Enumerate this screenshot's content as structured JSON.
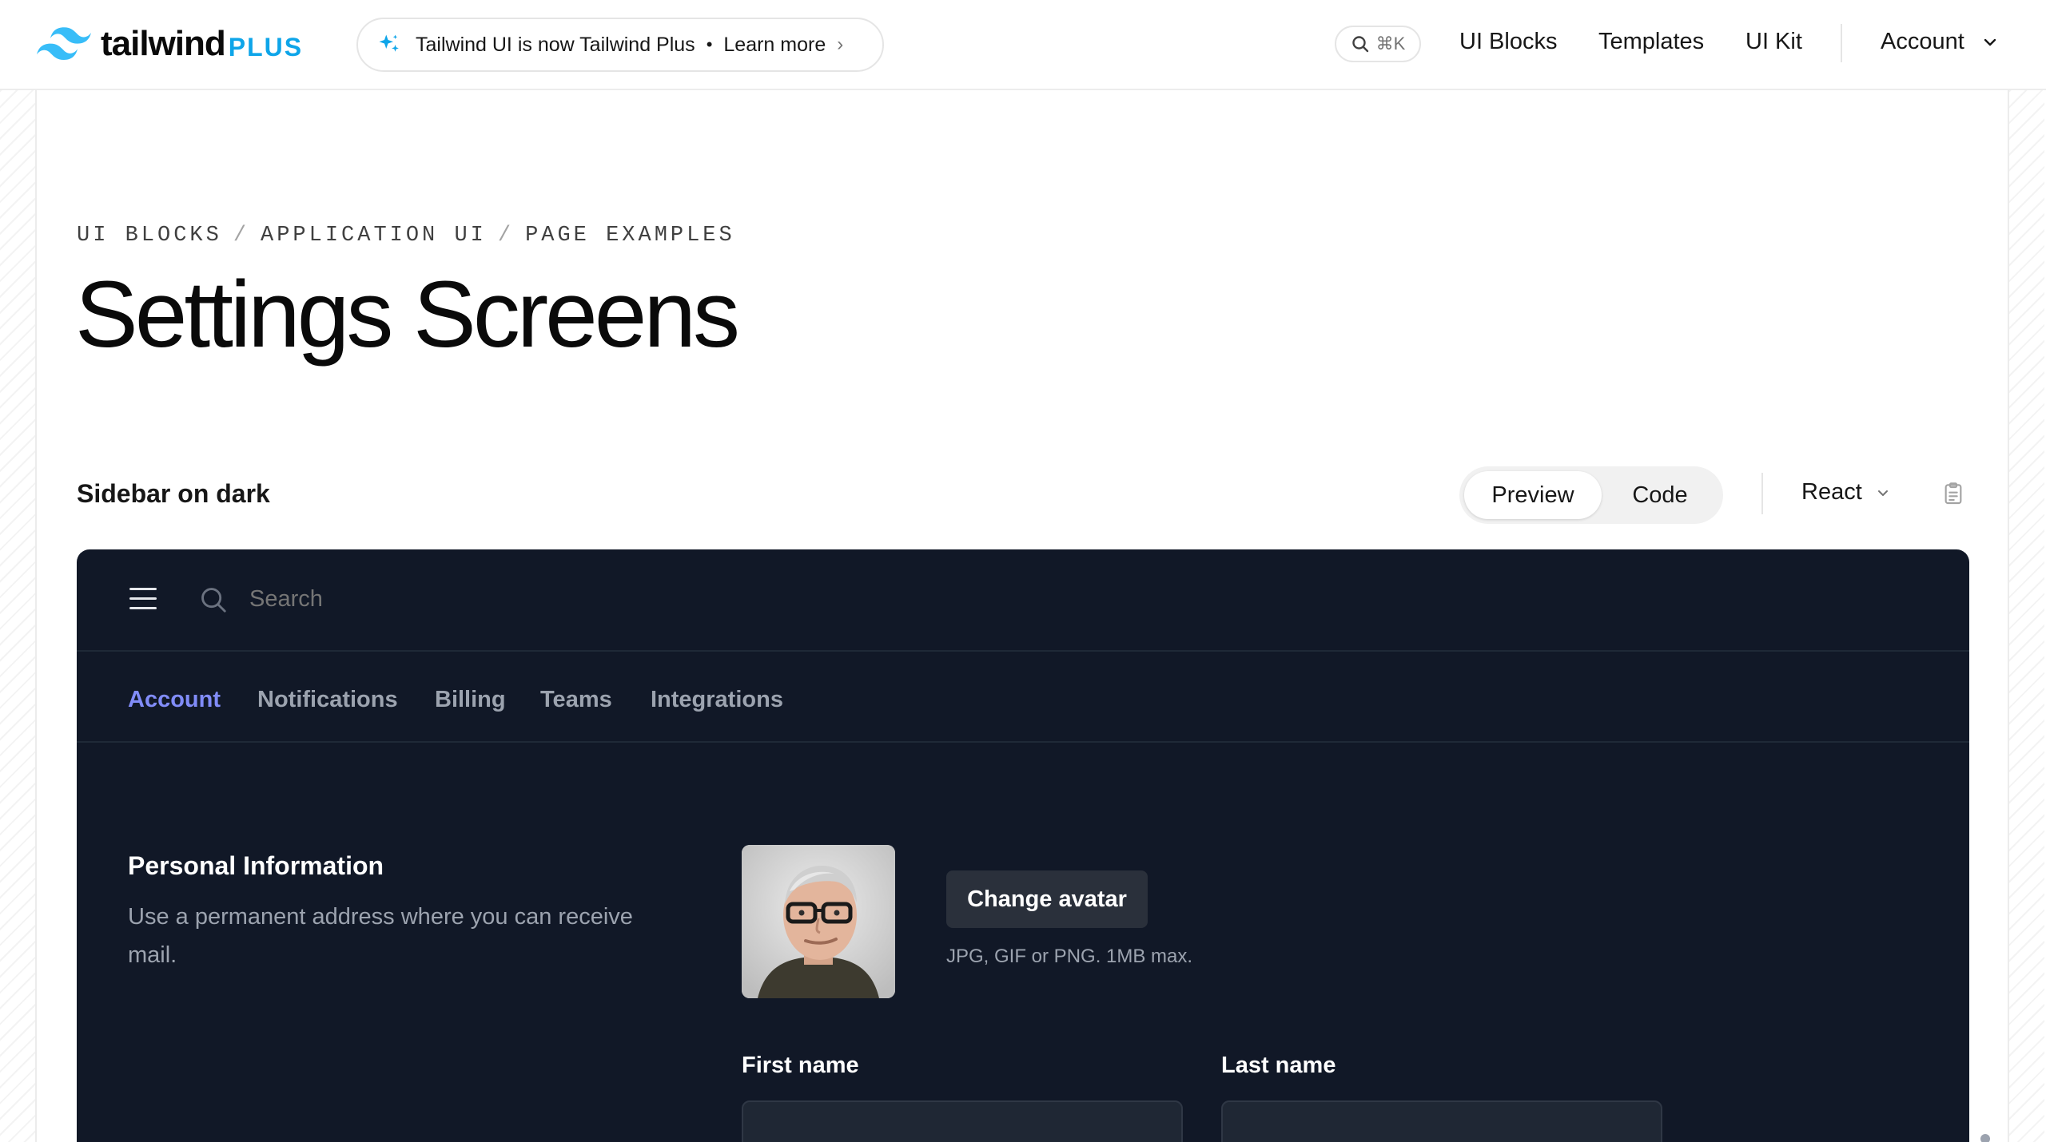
{
  "header": {
    "logo_word": "tailwind",
    "logo_plus": "PLUS",
    "announcement": "Tailwind UI is now Tailwind Plus",
    "announcement_link": "Learn more",
    "search_shortcut": "⌘K",
    "nav": [
      "UI Blocks",
      "Templates",
      "UI Kit"
    ],
    "account": "Account"
  },
  "breadcrumb": [
    "UI BLOCKS",
    "APPLICATION UI",
    "PAGE EXAMPLES"
  ],
  "page_title": "Settings Screens",
  "section": {
    "label": "Sidebar on dark",
    "toggle": [
      "Preview",
      "Code"
    ],
    "framework": "React"
  },
  "preview": {
    "search_placeholder": "Search",
    "tabs": [
      "Account",
      "Notifications",
      "Billing",
      "Teams",
      "Integrations"
    ],
    "active_tab": "Account",
    "personal_info_title": "Personal Information",
    "personal_info_desc": "Use a permanent address where you can receive mail.",
    "change_avatar": "Change avatar",
    "avatar_hint": "JPG, GIF or PNG. 1MB max.",
    "first_name_label": "First name",
    "last_name_label": "Last name"
  },
  "colors": {
    "brand": "#0ea5e9",
    "preview_bg": "#111827",
    "active_tab": "#818cf8"
  }
}
